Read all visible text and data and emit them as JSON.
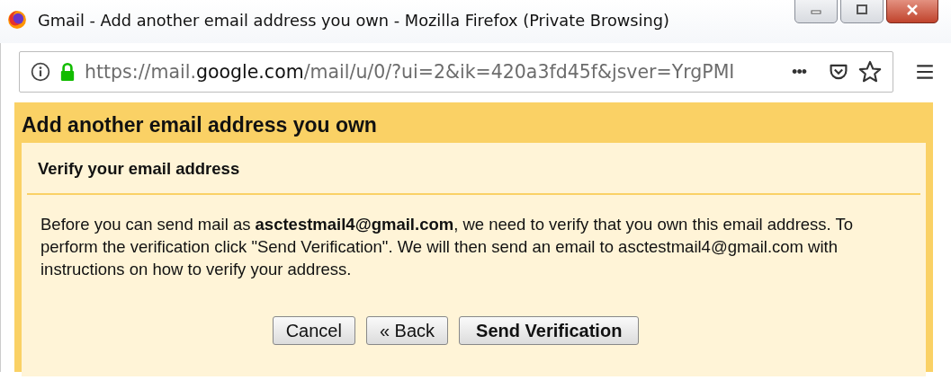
{
  "window": {
    "title": "Gmail - Add another email address you own - Mozilla Firefox (Private Browsing)"
  },
  "address_bar": {
    "url_prefix": "https://mail.",
    "url_domain": "google.com",
    "url_path": "/mail/u/0/?ui=2&ik=420a3fd45f&jsver=YrgPMI",
    "more": "•••"
  },
  "dialog": {
    "title": "Add another email address you own",
    "section_title": "Verify your email address",
    "message": "Before you can send mail as **asctestmail4@gmail.com**, we need to verify that you own this email address. To perform the verification click \"Send Verification\". We will then send an email to asctestmail4@gmail.com with instructions on how to verify your address.",
    "buttons": [
      {
        "label": "Cancel",
        "kind": "plain"
      },
      {
        "label": "« Back",
        "kind": "plain"
      },
      {
        "label": "Send Verification",
        "kind": "primary"
      }
    ]
  }
}
